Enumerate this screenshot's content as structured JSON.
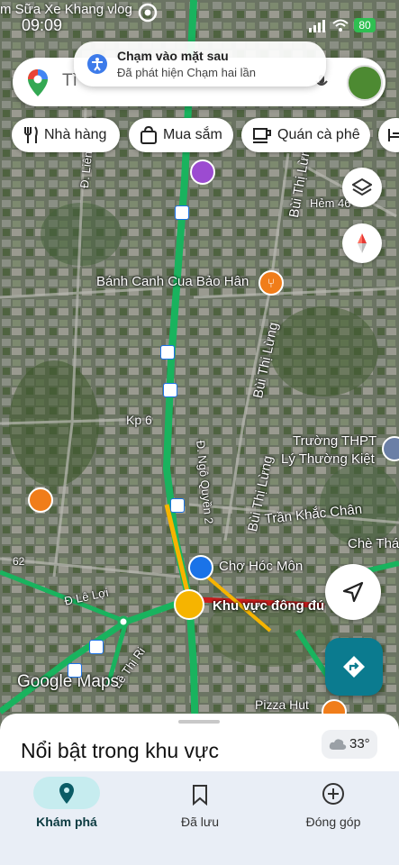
{
  "status_bar": {
    "title": "m Sữa Xe Khang vlog",
    "time": "09:09",
    "battery": "80"
  },
  "notification": {
    "title": "Chạm vào mặt sau",
    "subtitle": "Đã phát hiện Chạm hai lần"
  },
  "search": {
    "placeholder": "Tì"
  },
  "chips": [
    {
      "label": "Nhà hàng",
      "icon": "fork-knife-icon"
    },
    {
      "label": "Mua sắm",
      "icon": "shopping-bag-icon"
    },
    {
      "label": "Quán cà phê",
      "icon": "coffee-cup-icon"
    }
  ],
  "map_labels": {
    "hem": "Hẻm 46",
    "lien_xa": "Đ. Liên Xã Th",
    "bui_thi_lung_top": "Bùi Thị Lừng",
    "banh_canh": "Bánh Canh Cua Bảo Hân",
    "bui_thi_lung_mid": "Bùi Thị Lừng",
    "kp6": "Kp 6",
    "ngo_quyen": "Đ. Ngô Quyền 2",
    "bui_thi_lung_low": "Bùi Thị Lừng",
    "truong_thpt": "Trường THPT",
    "ly_thuong_kiet": "Lý Thường Kiệt",
    "tran_khac_chan": "Trần Khắc Chân",
    "che_thai": "Chè Thá",
    "cho_hoc_mon": "Chợ Hóc Môn",
    "khu_vuc": "Khu vực đông đú",
    "le_loi": "Đ Lê Lợi",
    "le_thi_ri": "Lê Thị Ri",
    "pizza": "Pizza Hut",
    "num62": "62",
    "google_maps": "Google Maps"
  },
  "sheet": {
    "title": "Nổi bật trong khu vực",
    "weather": "33°"
  },
  "nav": [
    {
      "label": "Khám phá",
      "icon": "location-pin-icon"
    },
    {
      "label": "Đã lưu",
      "icon": "bookmark-icon"
    },
    {
      "label": "Đóng góp",
      "icon": "plus-circle-icon"
    }
  ],
  "colors": {
    "accent": "#1a73e8",
    "route": "#19b35e",
    "directions": "#0b7b8f",
    "satellite": "#5a6a4f"
  }
}
